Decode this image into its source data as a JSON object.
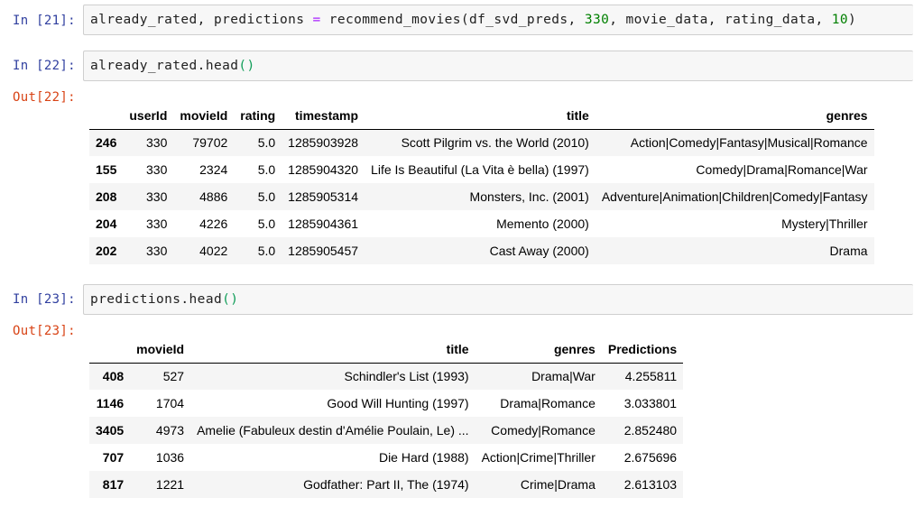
{
  "cells": [
    {
      "in_label": "In [21]:",
      "code_tokens": [
        {
          "t": "already_rated, predictions ",
          "c": ""
        },
        {
          "t": "=",
          "c": "tok-op"
        },
        {
          "t": " recommend_movies(df_svd_preds, ",
          "c": ""
        },
        {
          "t": "330",
          "c": "tok-num"
        },
        {
          "t": ", movie_data, rating_data, ",
          "c": ""
        },
        {
          "t": "10",
          "c": "tok-num"
        },
        {
          "t": ")",
          "c": ""
        }
      ]
    },
    {
      "in_label": "In [22]:",
      "code_tokens": [
        {
          "t": "already_rated.head",
          "c": ""
        },
        {
          "t": "()",
          "c": "tok-paren"
        }
      ],
      "out_label": "Out[22]:",
      "table": {
        "columns": [
          "",
          "userId",
          "movieId",
          "rating",
          "timestamp",
          "title",
          "genres"
        ],
        "rows": [
          [
            "246",
            "330",
            "79702",
            "5.0",
            "1285903928",
            "Scott Pilgrim vs. the World (2010)",
            "Action|Comedy|Fantasy|Musical|Romance"
          ],
          [
            "155",
            "330",
            "2324",
            "5.0",
            "1285904320",
            "Life Is Beautiful (La Vita è bella) (1997)",
            "Comedy|Drama|Romance|War"
          ],
          [
            "208",
            "330",
            "4886",
            "5.0",
            "1285905314",
            "Monsters, Inc. (2001)",
            "Adventure|Animation|Children|Comedy|Fantasy"
          ],
          [
            "204",
            "330",
            "4226",
            "5.0",
            "1285904361",
            "Memento (2000)",
            "Mystery|Thriller"
          ],
          [
            "202",
            "330",
            "4022",
            "5.0",
            "1285905457",
            "Cast Away (2000)",
            "Drama"
          ]
        ]
      }
    },
    {
      "in_label": "In [23]:",
      "code_tokens": [
        {
          "t": "predictions.head",
          "c": ""
        },
        {
          "t": "()",
          "c": "tok-paren"
        }
      ],
      "out_label": "Out[23]:",
      "table": {
        "columns": [
          "",
          "movieId",
          "title",
          "genres",
          "Predictions"
        ],
        "rows": [
          [
            "408",
            "527",
            "Schindler's List (1993)",
            "Drama|War",
            "4.255811"
          ],
          [
            "1146",
            "1704",
            "Good Will Hunting (1997)",
            "Drama|Romance",
            "3.033801"
          ],
          [
            "3405",
            "4973",
            "Amelie (Fabuleux destin d'Amélie Poulain, Le) ...",
            "Comedy|Romance",
            "2.852480"
          ],
          [
            "707",
            "1036",
            "Die Hard (1988)",
            "Action|Crime|Thriller",
            "2.675696"
          ],
          [
            "817",
            "1221",
            "Godfather: Part II, The (1974)",
            "Crime|Drama",
            "2.613103"
          ]
        ]
      }
    }
  ]
}
